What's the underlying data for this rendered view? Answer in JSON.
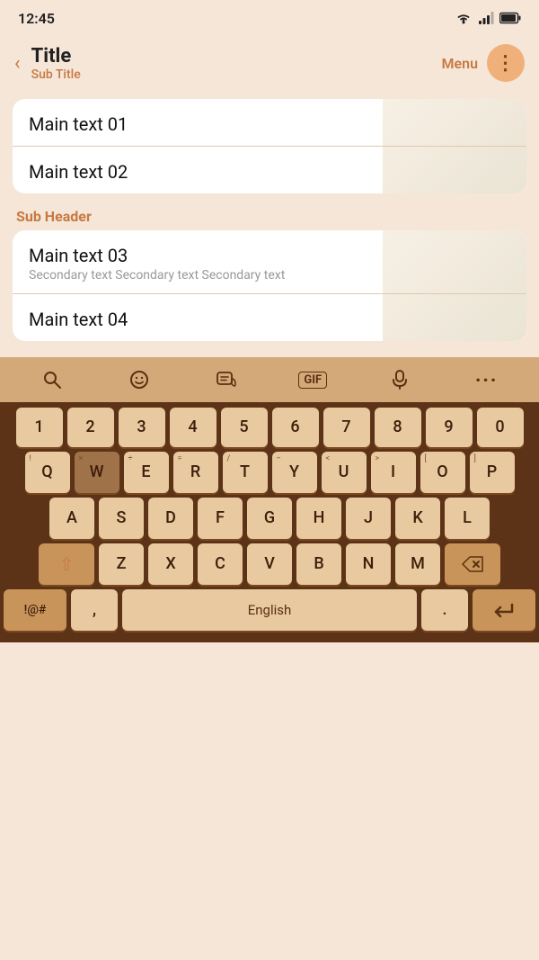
{
  "status": {
    "time": "12:45",
    "wifi_icon": "wifi",
    "signal_icon": "signal",
    "battery_icon": "battery"
  },
  "appbar": {
    "back_label": "‹",
    "title": "Title",
    "subtitle": "Sub Title",
    "menu_label": "Menu",
    "dots_icon": "⋮"
  },
  "content": {
    "items": [
      {
        "main": "Main text 01",
        "secondary": ""
      },
      {
        "main": "Main text 02",
        "secondary": ""
      }
    ],
    "subheader": "Sub Header",
    "items2": [
      {
        "main": "Main text 03",
        "secondary": "Secondary text Secondary text Secondary text"
      },
      {
        "main": "Main text 04",
        "secondary": ""
      }
    ]
  },
  "keyboard": {
    "toolbar": {
      "search_icon": "🔍",
      "emoji_icon": "☺",
      "sticker_icon": "🎭",
      "gif_label": "GIF",
      "mic_icon": "🎤",
      "more_icon": "···"
    },
    "rows": {
      "numbers": [
        "1",
        "2",
        "3",
        "4",
        "5",
        "6",
        "7",
        "8",
        "9",
        "0"
      ],
      "row1": [
        "Q",
        "W",
        "E",
        "R",
        "T",
        "Y",
        "U",
        "I",
        "O",
        "P"
      ],
      "row2": [
        "A",
        "S",
        "D",
        "F",
        "G",
        "H",
        "J",
        "K",
        "L"
      ],
      "row3": [
        "Z",
        "X",
        "C",
        "V",
        "B",
        "N",
        "M"
      ],
      "sub_chars": {
        "Q": "!",
        "W": "",
        "E": "@",
        "R": "#",
        "T": "%",
        "Y": "^",
        "U": "&",
        "I": "*",
        "O": "(",
        "P": ")",
        "A": "",
        "S": "",
        "D": "",
        "F": "",
        "G": "",
        "H": "",
        "J": "",
        "K": "",
        "L": "",
        "W2": "×",
        "E2": "÷",
        "R2": "=",
        "T2": "/",
        "Y2": "−",
        "U2": "<",
        "I2": ">",
        "O2": "[",
        "P2": "]"
      }
    },
    "special": {
      "shift_icon": "⇧",
      "backspace_icon": "⌫",
      "bottom_left": "!@#",
      "comma": ",",
      "space_label": "English",
      "period": ".",
      "enter_icon": "↵"
    }
  }
}
